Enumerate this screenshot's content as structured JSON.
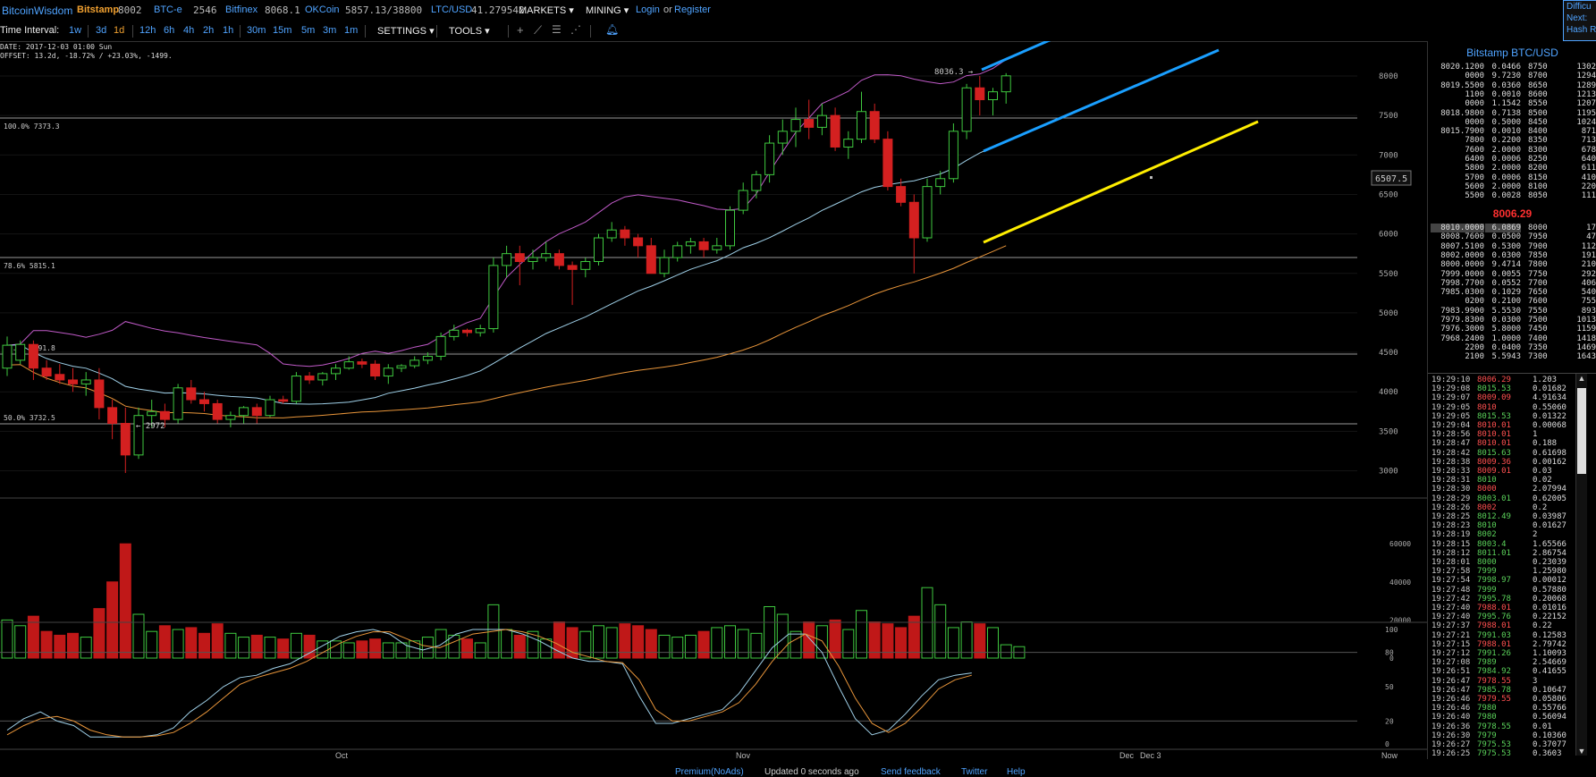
{
  "topbar": {
    "site": "BitcoinWisdom",
    "bitstamp_label": "Bitstamp",
    "bitstamp_value": "8002",
    "btce_label": "BTC-e",
    "btce_value": "2546",
    "bitfinex_label": "Bitfinex",
    "bitfinex_value": "8068.1",
    "okcoin_label": "OKCoin",
    "okcoin_value": "5857.13/38800",
    "ltc_label": "LTC/USD",
    "ltc_value": "41.279542",
    "markets": "MARKETS",
    "mining": "MINING",
    "login": "Login",
    "or": "or",
    "register": "Register"
  },
  "toolbar": {
    "time_interval_label": "Time Interval:",
    "intervals": [
      "1w",
      "3d",
      "1d",
      "12h",
      "6h",
      "4h",
      "2h",
      "1h",
      "30m",
      "15m",
      "5m",
      "3m",
      "1m"
    ],
    "active_interval": "1d",
    "settings": "SETTINGS",
    "tools": "TOOLS"
  },
  "difficulty": {
    "line1": "Difficu",
    "line2": "Next:",
    "line3": "Hash R"
  },
  "chart": {
    "info_date": "DATE: 2017-12-03 01:00 Sun",
    "info_offset": "OFFSET: 13.2d, -18.72% / +23.03%, -1499.",
    "fib_100": "100.0% 7373.3",
    "fib_786": "78.6% 5815.1",
    "fib_618": "61.8% 4591.8",
    "fib_50": "50.0% 3732.5",
    "low_label": "← 2972",
    "high_label": "8036.3 →",
    "cursor_price": "6507.5",
    "price_axis": [
      "8000",
      "7500",
      "7000",
      "6500",
      "6000",
      "5500",
      "5000",
      "4500",
      "4000",
      "3500",
      "3000"
    ],
    "volume_axis": [
      "60000",
      "40000",
      "20000",
      "0"
    ],
    "stoch_axis": [
      "100",
      "80",
      "50",
      "20",
      "0"
    ],
    "x_axis": [
      "Oct",
      "Nov",
      "Dec",
      "Dec 3",
      "Now"
    ]
  },
  "chart_data": {
    "type": "candlestick",
    "ylim": [
      2900,
      8300
    ],
    "candles": [
      {
        "o": 4300,
        "h": 4700,
        "l": 4200,
        "c": 4590
      },
      {
        "o": 4400,
        "h": 4650,
        "l": 4350,
        "c": 4600
      },
      {
        "o": 4600,
        "h": 4650,
        "l": 4150,
        "c": 4300
      },
      {
        "o": 4300,
        "h": 4400,
        "l": 4150,
        "c": 4200
      },
      {
        "o": 4220,
        "h": 4350,
        "l": 4100,
        "c": 4150
      },
      {
        "o": 4150,
        "h": 4300,
        "l": 4000,
        "c": 4100
      },
      {
        "o": 4100,
        "h": 4250,
        "l": 3950,
        "c": 4150
      },
      {
        "o": 4150,
        "h": 4300,
        "l": 3650,
        "c": 3800
      },
      {
        "o": 3800,
        "h": 3900,
        "l": 3400,
        "c": 3600
      },
      {
        "o": 3600,
        "h": 3800,
        "l": 2972,
        "c": 3200
      },
      {
        "o": 3200,
        "h": 3800,
        "l": 3150,
        "c": 3700
      },
      {
        "o": 3700,
        "h": 3900,
        "l": 3550,
        "c": 3750
      },
      {
        "o": 3750,
        "h": 3850,
        "l": 3550,
        "c": 3650
      },
      {
        "o": 3650,
        "h": 4100,
        "l": 3600,
        "c": 4050
      },
      {
        "o": 4050,
        "h": 4150,
        "l": 3850,
        "c": 3900
      },
      {
        "o": 3900,
        "h": 4000,
        "l": 3750,
        "c": 3850
      },
      {
        "o": 3850,
        "h": 3900,
        "l": 3600,
        "c": 3650
      },
      {
        "o": 3650,
        "h": 3750,
        "l": 3550,
        "c": 3700
      },
      {
        "o": 3700,
        "h": 3820,
        "l": 3600,
        "c": 3800
      },
      {
        "o": 3800,
        "h": 3850,
        "l": 3600,
        "c": 3700
      },
      {
        "o": 3700,
        "h": 3950,
        "l": 3680,
        "c": 3900
      },
      {
        "o": 3900,
        "h": 3950,
        "l": 3850,
        "c": 3880
      },
      {
        "o": 3880,
        "h": 4250,
        "l": 3850,
        "c": 4200
      },
      {
        "o": 4200,
        "h": 4250,
        "l": 4100,
        "c": 4150
      },
      {
        "o": 4150,
        "h": 4250,
        "l": 4080,
        "c": 4230
      },
      {
        "o": 4230,
        "h": 4350,
        "l": 4150,
        "c": 4300
      },
      {
        "o": 4300,
        "h": 4450,
        "l": 4280,
        "c": 4380
      },
      {
        "o": 4380,
        "h": 4420,
        "l": 4300,
        "c": 4350
      },
      {
        "o": 4350,
        "h": 4400,
        "l": 4150,
        "c": 4200
      },
      {
        "o": 4200,
        "h": 4350,
        "l": 4100,
        "c": 4300
      },
      {
        "o": 4300,
        "h": 4350,
        "l": 4250,
        "c": 4330
      },
      {
        "o": 4330,
        "h": 4450,
        "l": 4300,
        "c": 4400
      },
      {
        "o": 4400,
        "h": 4500,
        "l": 4350,
        "c": 4450
      },
      {
        "o": 4450,
        "h": 4750,
        "l": 4400,
        "c": 4700
      },
      {
        "o": 4700,
        "h": 4850,
        "l": 4650,
        "c": 4780
      },
      {
        "o": 4780,
        "h": 4800,
        "l": 4700,
        "c": 4750
      },
      {
        "o": 4750,
        "h": 4850,
        "l": 4700,
        "c": 4800
      },
      {
        "o": 4800,
        "h": 5700,
        "l": 4750,
        "c": 5600
      },
      {
        "o": 5600,
        "h": 5850,
        "l": 5450,
        "c": 5750
      },
      {
        "o": 5750,
        "h": 5850,
        "l": 5350,
        "c": 5650
      },
      {
        "o": 5650,
        "h": 5800,
        "l": 5550,
        "c": 5700
      },
      {
        "o": 5700,
        "h": 5900,
        "l": 5650,
        "c": 5750
      },
      {
        "o": 5750,
        "h": 5800,
        "l": 5550,
        "c": 5600
      },
      {
        "o": 5600,
        "h": 5650,
        "l": 5100,
        "c": 5550
      },
      {
        "o": 5550,
        "h": 5700,
        "l": 5450,
        "c": 5650
      },
      {
        "o": 5650,
        "h": 6000,
        "l": 5600,
        "c": 5950
      },
      {
        "o": 5950,
        "h": 6150,
        "l": 5900,
        "c": 6050
      },
      {
        "o": 6050,
        "h": 6100,
        "l": 5850,
        "c": 5950
      },
      {
        "o": 5950,
        "h": 6000,
        "l": 5700,
        "c": 5850
      },
      {
        "o": 5850,
        "h": 5950,
        "l": 5500,
        "c": 5500
      },
      {
        "o": 5500,
        "h": 5800,
        "l": 5450,
        "c": 5700
      },
      {
        "o": 5700,
        "h": 5900,
        "l": 5650,
        "c": 5850
      },
      {
        "o": 5850,
        "h": 5950,
        "l": 5750,
        "c": 5900
      },
      {
        "o": 5900,
        "h": 5950,
        "l": 5700,
        "c": 5800
      },
      {
        "o": 5800,
        "h": 5950,
        "l": 5750,
        "c": 5850
      },
      {
        "o": 5850,
        "h": 6350,
        "l": 5800,
        "c": 6300
      },
      {
        "o": 6300,
        "h": 6650,
        "l": 6250,
        "c": 6550
      },
      {
        "o": 6550,
        "h": 6800,
        "l": 6450,
        "c": 6750
      },
      {
        "o": 6750,
        "h": 7250,
        "l": 6650,
        "c": 7150
      },
      {
        "o": 7150,
        "h": 7450,
        "l": 7000,
        "c": 7300
      },
      {
        "o": 7300,
        "h": 7600,
        "l": 7100,
        "c": 7450
      },
      {
        "o": 7450,
        "h": 7700,
        "l": 7200,
        "c": 7350
      },
      {
        "o": 7350,
        "h": 7650,
        "l": 7250,
        "c": 7500
      },
      {
        "o": 7500,
        "h": 7600,
        "l": 7050,
        "c": 7100
      },
      {
        "o": 7100,
        "h": 7300,
        "l": 6950,
        "c": 7200
      },
      {
        "o": 7200,
        "h": 7800,
        "l": 7150,
        "c": 7550
      },
      {
        "o": 7550,
        "h": 7650,
        "l": 7150,
        "c": 7200
      },
      {
        "o": 7200,
        "h": 7300,
        "l": 6550,
        "c": 6600
      },
      {
        "o": 6600,
        "h": 6700,
        "l": 6350,
        "c": 6400
      },
      {
        "o": 6400,
        "h": 6500,
        "l": 5500,
        "c": 5950
      },
      {
        "o": 5950,
        "h": 6700,
        "l": 5900,
        "c": 6600
      },
      {
        "o": 6600,
        "h": 6800,
        "l": 6500,
        "c": 6700
      },
      {
        "o": 6700,
        "h": 7400,
        "l": 6650,
        "c": 7300
      },
      {
        "o": 7300,
        "h": 7900,
        "l": 7200,
        "c": 7850
      },
      {
        "o": 7850,
        "h": 8000,
        "l": 7500,
        "c": 7700
      },
      {
        "o": 7700,
        "h": 7850,
        "l": 7500,
        "c": 7800
      },
      {
        "o": 7800,
        "h": 8036.3,
        "l": 7650,
        "c": 8002
      }
    ],
    "volume": [
      20000,
      17000,
      22000,
      14000,
      12000,
      13000,
      11000,
      26000,
      40000,
      60000,
      23000,
      14000,
      17000,
      15000,
      16000,
      13000,
      18000,
      13000,
      11000,
      12000,
      11000,
      10000,
      13000,
      12000,
      9000,
      9000,
      8000,
      9000,
      10000,
      8000,
      8000,
      9000,
      11000,
      15000,
      12000,
      10000,
      8000,
      28000,
      15000,
      12000,
      14000,
      10000,
      19000,
      16000,
      14000,
      17000,
      16000,
      18000,
      17000,
      15000,
      12000,
      11000,
      12000,
      14000,
      16000,
      17000,
      15000,
      13000,
      27000,
      23000,
      14000,
      19000,
      17000,
      20000,
      15000,
      25000,
      19000,
      18000,
      16000,
      22000,
      37000,
      28000,
      16000,
      19000,
      18000,
      16000,
      7000,
      6000
    ],
    "stoch_k": [
      12,
      22,
      28,
      20,
      16,
      6,
      6,
      6,
      6,
      8,
      14,
      28,
      38,
      50,
      58,
      60,
      66,
      70,
      78,
      86,
      94,
      98,
      100,
      96,
      86,
      82,
      86,
      96,
      100,
      100,
      100,
      96,
      90,
      82,
      75,
      72,
      72,
      70,
      42,
      18,
      18,
      22,
      26,
      30,
      44,
      64,
      84,
      96,
      96,
      80,
      50,
      22,
      8,
      12,
      26,
      42,
      56,
      60,
      62
    ],
    "stoch_d": [
      8,
      16,
      22,
      24,
      20,
      12,
      8,
      6,
      6,
      7,
      10,
      18,
      28,
      40,
      52,
      58,
      62,
      66,
      72,
      80,
      88,
      94,
      98,
      98,
      92,
      86,
      84,
      90,
      96,
      98,
      100,
      98,
      94,
      88,
      80,
      76,
      72,
      71,
      56,
      30,
      20,
      20,
      24,
      28,
      36,
      52,
      72,
      88,
      96,
      90,
      68,
      40,
      18,
      10,
      18,
      32,
      48,
      56,
      60
    ]
  },
  "orderbook": {
    "title": "Bitstamp BTC/USD",
    "current_price": "8006.29",
    "asks": [
      [
        "8020.1200",
        "0.0466",
        "8750",
        "1302"
      ],
      [
        "0000",
        "9.7230",
        "8700",
        "1294"
      ],
      [
        "8019.5500",
        "0.0360",
        "8650",
        "1289"
      ],
      [
        "1100",
        "0.0010",
        "8600",
        "1213"
      ],
      [
        "0000",
        "1.1542",
        "8550",
        "1207"
      ],
      [
        "8018.9800",
        "0.7138",
        "8500",
        "1195"
      ],
      [
        "0000",
        "0.5000",
        "8450",
        "1024"
      ],
      [
        "8015.7900",
        "0.0010",
        "8400",
        "871"
      ],
      [
        "7800",
        "0.2200",
        "8350",
        "713"
      ],
      [
        "7600",
        "2.0000",
        "8300",
        "678"
      ],
      [
        "6400",
        "0.0006",
        "8250",
        "640"
      ],
      [
        "5800",
        "2.0000",
        "8200",
        "611"
      ],
      [
        "5700",
        "0.0006",
        "8150",
        "410"
      ],
      [
        "5600",
        "2.0000",
        "8100",
        "220"
      ],
      [
        "5500",
        "0.0028",
        "8050",
        "111"
      ]
    ],
    "bids": [
      [
        "8010.0000",
        "6.0869",
        "8000",
        "17"
      ],
      [
        "8008.7600",
        "0.0500",
        "7950",
        "47"
      ],
      [
        "8007.5100",
        "0.5300",
        "7900",
        "112"
      ],
      [
        "8002.0000",
        "0.0300",
        "7850",
        "191"
      ],
      [
        "8000.0000",
        "9.4714",
        "7800",
        "210"
      ],
      [
        "7999.0000",
        "0.0055",
        "7750",
        "292"
      ],
      [
        "7998.7700",
        "0.0552",
        "7700",
        "406"
      ],
      [
        "7985.0300",
        "0.1029",
        "7650",
        "540"
      ],
      [
        "0200",
        "0.2100",
        "7600",
        "755"
      ],
      [
        "7983.9900",
        "5.5530",
        "7550",
        "893"
      ],
      [
        "7979.8300",
        "0.0300",
        "7500",
        "1013"
      ],
      [
        "7976.3000",
        "5.8000",
        "7450",
        "1159"
      ],
      [
        "7968.2400",
        "1.0000",
        "7400",
        "1418"
      ],
      [
        "2200",
        "0.0400",
        "7350",
        "1469"
      ],
      [
        "2100",
        "5.5943",
        "7300",
        "1643"
      ]
    ]
  },
  "trades": [
    [
      "19:29:10",
      "8006.29",
      "1.203",
      "red"
    ],
    [
      "19:29:08",
      "8015.53",
      "0.01682",
      "green"
    ],
    [
      "19:29:07",
      "8009.09",
      "4.91634",
      "red"
    ],
    [
      "19:29:05",
      "8010",
      "0.55060",
      "red"
    ],
    [
      "19:29:05",
      "8015.53",
      "0.01322",
      "green"
    ],
    [
      "19:29:04",
      "8010.01",
      "0.00068",
      "red"
    ],
    [
      "19:28:56",
      "8010.01",
      "1",
      "red"
    ],
    [
      "19:28:47",
      "8010.01",
      "0.188",
      "red"
    ],
    [
      "19:28:42",
      "8015.63",
      "0.61698",
      "green"
    ],
    [
      "19:28:38",
      "8009.36",
      "0.00162",
      "red"
    ],
    [
      "19:28:33",
      "8009.01",
      "0.03",
      "red"
    ],
    [
      "19:28:31",
      "8010",
      "0.02",
      "green"
    ],
    [
      "19:28:30",
      "8000",
      "2.07994",
      "red"
    ],
    [
      "19:28:29",
      "8003.01",
      "0.62005",
      "green"
    ],
    [
      "19:28:26",
      "8002",
      "0.2",
      "red"
    ],
    [
      "19:28:25",
      "8012.49",
      "0.03987",
      "green"
    ],
    [
      "19:28:23",
      "8010",
      "0.01627",
      "green"
    ],
    [
      "19:28:19",
      "8002",
      "2",
      "green"
    ],
    [
      "19:28:15",
      "8003.4",
      "1.65566",
      "green"
    ],
    [
      "19:28:12",
      "8011.01",
      "2.86754",
      "green"
    ],
    [
      "19:28:01",
      "8000",
      "0.23039",
      "green"
    ],
    [
      "19:27:58",
      "7999",
      "1.25980",
      "green"
    ],
    [
      "19:27:54",
      "7998.97",
      "0.00012",
      "green"
    ],
    [
      "19:27:48",
      "7999",
      "0.57880",
      "green"
    ],
    [
      "19:27:42",
      "7995.78",
      "0.20068",
      "green"
    ],
    [
      "19:27:40",
      "7988.01",
      "0.01016",
      "red"
    ],
    [
      "19:27:40",
      "7995.76",
      "0.22152",
      "green"
    ],
    [
      "19:27:37",
      "7988.01",
      "0.22",
      "red"
    ],
    [
      "19:27:21",
      "7991.03",
      "0.12583",
      "green"
    ],
    [
      "19:27:15",
      "7988.01",
      "2.79742",
      "red"
    ],
    [
      "19:27:12",
      "7991.26",
      "1.10093",
      "green"
    ],
    [
      "19:27:08",
      "7989",
      "2.54669",
      "green"
    ],
    [
      "19:26:51",
      "7984.92",
      "0.41655",
      "green"
    ],
    [
      "19:26:47",
      "7978.55",
      "3",
      "red"
    ],
    [
      "19:26:47",
      "7985.78",
      "0.10647",
      "green"
    ],
    [
      "19:26:46",
      "7979.55",
      "0.05806",
      "red"
    ],
    [
      "19:26:46",
      "7980",
      "0.55766",
      "green"
    ],
    [
      "19:26:40",
      "7980",
      "0.56094",
      "green"
    ],
    [
      "19:26:36",
      "7978.55",
      "0.01",
      "green"
    ],
    [
      "19:26:30",
      "7979",
      "0.10360",
      "green"
    ],
    [
      "19:26:27",
      "7975.53",
      "0.37077",
      "green"
    ],
    [
      "19:26:25",
      "7975.53",
      "0.3603",
      "green"
    ]
  ],
  "footer": {
    "premium": "Premium(NoAds)",
    "updated": "Updated 0 seconds ago",
    "feedback": "Send feedback",
    "twitter": "Twitter",
    "help": "Help"
  }
}
